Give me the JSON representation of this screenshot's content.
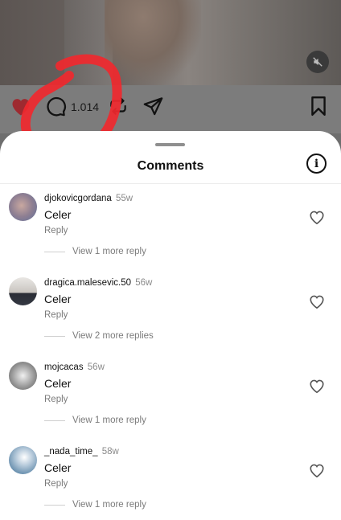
{
  "post": {
    "like_count": "1.014",
    "icons": [
      "heart-filled-icon",
      "comment-icon",
      "repost-icon",
      "share-icon",
      "bookmark-icon",
      "mute-icon"
    ],
    "accent_color": "#d9343f"
  },
  "sheet": {
    "title": "Comments",
    "info_icon": "i"
  },
  "comments": [
    {
      "username": "djokovicgordana",
      "ago": "55w",
      "text": "Celer",
      "reply": "Reply",
      "view_more": "View 1 more reply"
    },
    {
      "username": "dragica.malesevic.50",
      "ago": "56w",
      "text": "Celer",
      "reply": "Reply",
      "view_more": "View 2 more replies"
    },
    {
      "username": "mojcacas",
      "ago": "56w",
      "text": "Celer",
      "reply": "Reply",
      "view_more": "View 1 more reply"
    },
    {
      "username": "_nada_time_",
      "ago": "58w",
      "text": "Celer",
      "reply": "Reply",
      "view_more": "View 1 more reply"
    }
  ]
}
